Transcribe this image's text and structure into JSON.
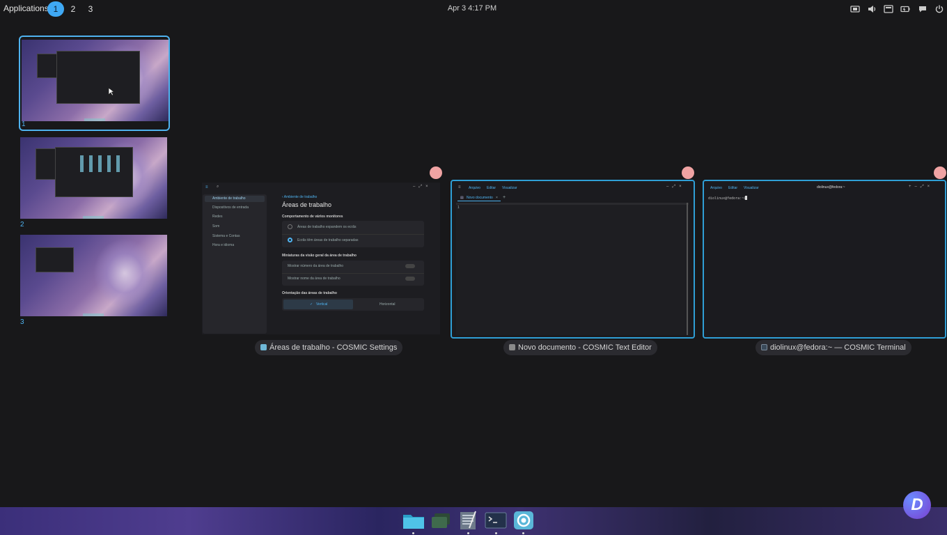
{
  "topbar": {
    "applications_label": "Applications",
    "workspaces": [
      "1",
      "2",
      "3"
    ],
    "active_workspace": "1",
    "clock": "Apr 3  4:17 PM",
    "tray_icons": [
      "screen-share-icon",
      "volume-icon",
      "display-icon",
      "battery-icon",
      "notification-icon",
      "power-icon"
    ]
  },
  "workspace_thumbnails": [
    {
      "label": "1",
      "selected": true
    },
    {
      "label": "2",
      "selected": false
    },
    {
      "label": "3",
      "selected": false
    }
  ],
  "windows": {
    "settings": {
      "caption": "Áreas de trabalho - COSMIC Settings",
      "sidebar": [
        "Ambiente de trabalho",
        "Dispositivos de entrada",
        "Redes",
        "Som",
        "Sistema e Contas",
        "Hora e idioma"
      ],
      "breadcrumb": "Ambiente de trabalho",
      "page_title": "Áreas de trabalho",
      "section_behavior": "Comportamento de vários monitores",
      "option_span": "Áreas de trabalho expandem os ecrãs",
      "option_separate": "Ecrãs têm áreas de trabalho separadas",
      "section_thumbnails": "Miniaturas da visão geral da área de trabalho",
      "toggle_number": "Mostrar número da área de trabalho",
      "toggle_name": "Mostrar nome da área de trabalho",
      "section_orientation": "Orientação das áreas de trabalho",
      "orientation_vertical": "Vertical",
      "orientation_horizontal": "Horizontal"
    },
    "text_editor": {
      "caption": "Novo documento - COSMIC Text Editor",
      "menu": [
        "Arquivo",
        "Editar",
        "Visualizar"
      ],
      "tab_label": "Novo documento",
      "line_number": "1"
    },
    "terminal": {
      "caption": "diolinux@fedora:~ — COSMIC Terminal",
      "menu": [
        "Arquivo",
        "Editar",
        "Visualizar"
      ],
      "title": "diolinux@fedora:~",
      "prompt": "diolinux@fedora:~$"
    }
  },
  "dock": {
    "items": [
      "files-icon",
      "workspaces-icon",
      "text-editor-icon",
      "terminal-icon",
      "settings-icon"
    ]
  },
  "watermark_letter": "D",
  "colors": {
    "accent": "#3fa9f5",
    "close_dot": "#f0a3a3",
    "background": "#18181a"
  }
}
